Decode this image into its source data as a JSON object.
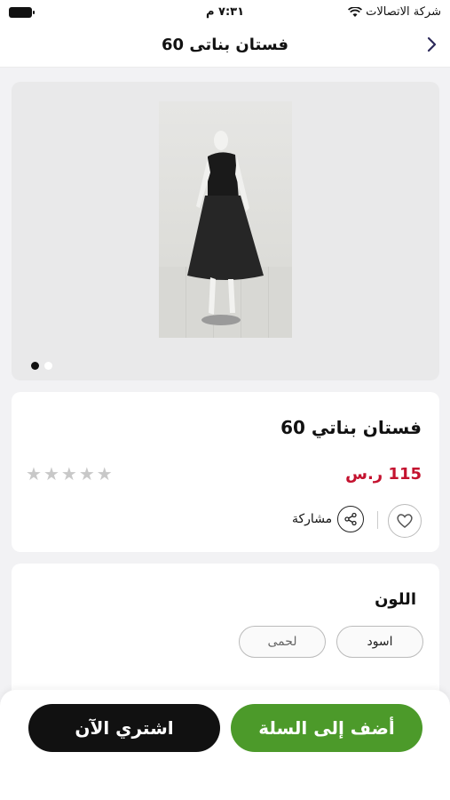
{
  "status_bar": {
    "carrier": "شركة الاتصالات",
    "time": "٧:٣١ م"
  },
  "nav": {
    "title": "فستان بناتى 60",
    "back_icon": "chevron-left-icon"
  },
  "gallery": {
    "image_alt": "black dress on mannequin",
    "dots": 2,
    "active_dot": 1
  },
  "product": {
    "name": "فستان بناتي 60",
    "price": "115 ر.س",
    "rating_stars": 5,
    "rating_value": 0,
    "share_label": "مشاركة",
    "colors": {
      "price": "#c4122f",
      "accent": "#4c9a2a"
    }
  },
  "options": {
    "color_label": "اللون",
    "color_options": [
      "اسود",
      "لحمى"
    ]
  },
  "actions": {
    "add_to_cart": "أضف إلى السلة",
    "buy_now": "اشتري الآن"
  }
}
